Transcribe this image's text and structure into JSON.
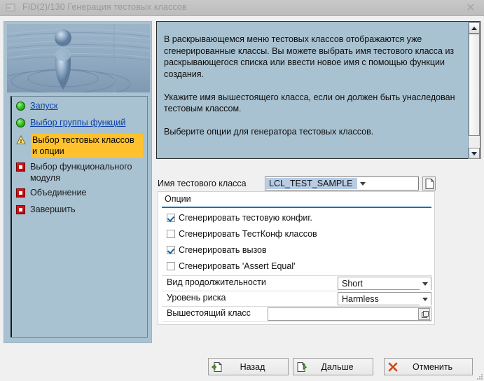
{
  "window": {
    "title": "FID(2)/130 Генерация тестовых классов",
    "close_label": "✕",
    "icon": "window-icon"
  },
  "sidebar": {
    "image_alt": "water-drop-splash-image",
    "steps": [
      {
        "label": "Запуск",
        "state": "done",
        "icon": "green-ball-icon"
      },
      {
        "label": "Выбор группы функций",
        "state": "done",
        "icon": "green-ball-icon"
      },
      {
        "label": "Выбор тестовых классов и опции",
        "state": "current",
        "icon": "warning-triangle-icon"
      },
      {
        "label": "Выбор функционального модуля",
        "state": "pending",
        "icon": "red-square-icon"
      },
      {
        "label": "Объединение",
        "state": "pending",
        "icon": "red-square-icon"
      },
      {
        "label": "Завершить",
        "state": "pending",
        "icon": "red-square-icon"
      }
    ]
  },
  "help": {
    "text": "В раскрывающемся меню тестовых классов отображаются уже сгенерированные классы. Вы можете выбрать имя тестового класса из раскрывающегося списка или ввести новое имя с помощью функции создания.\n\nУкажите имя вышестоящего класса, если он должен быть унаследован тестовым классом.\n\nВыберите опции для генератора тестовых классов."
  },
  "form": {
    "class_name_label": "Имя тестового класса",
    "class_name_value": "LCL_TEST_SAMPLE",
    "new_button_icon": "new-document-icon",
    "options_group_title": "Опции",
    "checkboxes": [
      {
        "label": "Сгенерировать тестовую конфиг.",
        "checked": true
      },
      {
        "label": "Сгенерировать ТестКонф классов",
        "checked": false
      },
      {
        "label": "Сгенерировать вызов",
        "checked": true
      },
      {
        "label": "Сгенерировать 'Assert Equal'",
        "checked": false
      }
    ],
    "duration_label": "Вид продолжительности",
    "duration_value": "Short",
    "risk_label": "Уровень риска",
    "risk_value": "Harmless",
    "superclass_label": "Вышестоящий класс",
    "superclass_value": "",
    "superclass_placeholder": "",
    "superclass_help_icon": "search-help-icon"
  },
  "buttons": {
    "back": {
      "label": "Назад",
      "icon": "arrow-left-document-icon"
    },
    "next": {
      "label": "Дальше",
      "icon": "arrow-right-document-icon"
    },
    "cancel": {
      "label": "Отменить",
      "icon": "red-x-icon"
    }
  },
  "colors": {
    "accent_blue": "#0a6ebd",
    "panel_blue": "#a9c2d1",
    "highlight_yellow": "#ffc22e",
    "selection_blue": "#b8cce4",
    "cancel_red": "#d1430f"
  }
}
